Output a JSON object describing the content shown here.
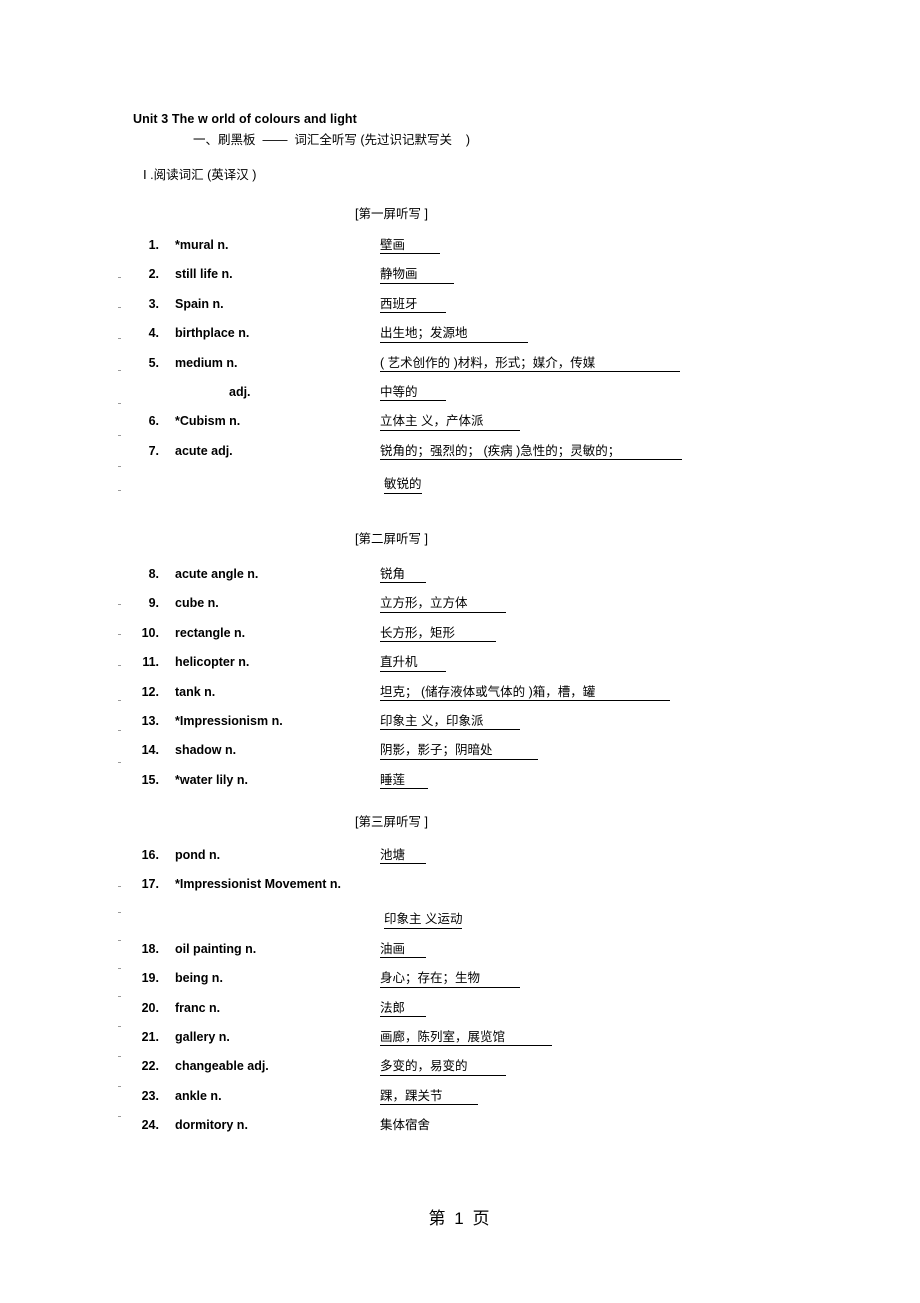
{
  "document": {
    "title": "Unit 3 The w orld of colours and light",
    "subtitle": "一、刷黑板  ——  词汇全听写 (先过识记默写关    )",
    "section_heading": "Ⅰ .阅读词汇 (英译汉 )",
    "page_footer_prefix": "第",
    "page_number": "1",
    "page_footer_suffix": "页"
  },
  "screens": [
    {
      "label": "[第一屏听写  ]",
      "entries": [
        {
          "num": "1.",
          "term": "*mural  n.",
          "meaning": "壁画",
          "indent": false
        },
        {
          "num": "2.",
          "term": "still life n.",
          "meaning": "静物画",
          "indent": false
        },
        {
          "num": "3.",
          "term": "Spain n.",
          "meaning": "西班牙",
          "indent": false
        },
        {
          "num": "4.",
          "term": "birthplace n.",
          "meaning": "出生地；发源地",
          "indent": false
        },
        {
          "num": "5.",
          "term": "medium n.",
          "meaning": "( 艺术创作的  )材料，形式；媒介，传媒",
          "indent": false
        },
        {
          "num": "",
          "term": "adj.",
          "meaning": "中等的",
          "indent": true
        },
        {
          "num": "6.",
          "term": "*Cubism n.",
          "meaning": "立体主 义，产体派",
          "indent": false
        },
        {
          "num": "7.",
          "term": "acute adj.",
          "meaning": "锐角的；强烈的； (疾病 )急性的；灵敏的；",
          "indent": false,
          "continuation": "敏锐的"
        }
      ]
    },
    {
      "label": "[第二屏听写  ]",
      "entries": [
        {
          "num": "8.",
          "term": "acute angle n.",
          "meaning": "锐角",
          "indent": false
        },
        {
          "num": "9.",
          "term": "cube n.",
          "meaning": "立方形，立方体",
          "indent": false
        },
        {
          "num": "10.",
          "term": "rectangle n.",
          "meaning": "长方形，矩形",
          "indent": false
        },
        {
          "num": "11.",
          "term": "helicopter n.",
          "meaning": "直升机",
          "indent": false
        },
        {
          "num": "12.",
          "term": "tank n.",
          "meaning": "坦克； (储存液体或气体的      )箱，槽，罐",
          "indent": false
        },
        {
          "num": "13.",
          "term": "*Impressionism n.",
          "meaning": "印象主 义，印象派",
          "indent": false
        },
        {
          "num": "14.",
          "term": "shadow n.",
          "meaning": "阴影，影子；阴暗处",
          "indent": false
        },
        {
          "num": "15.",
          "term": "*water lily  n.",
          "meaning": "睡莲",
          "indent": false
        }
      ]
    },
    {
      "label": "[第三屏听写  ]",
      "entries": [
        {
          "num": "16.",
          "term": "pond n.",
          "meaning": "池塘",
          "indent": false
        },
        {
          "num": "17.",
          "term": "*Impressionist Movement n.",
          "meaning": "",
          "indent": false,
          "continuation": "印象主 义运动"
        },
        {
          "num": "18.",
          "term": "oil painting n.",
          "meaning": "油画",
          "indent": false
        },
        {
          "num": "19.",
          "term": "being n.",
          "meaning": "身心；存在；生物",
          "indent": false
        },
        {
          "num": "20.",
          "term": "franc n.",
          "meaning": "法郎",
          "indent": false
        },
        {
          "num": "21.",
          "term": "gallery n.",
          "meaning": "画廊，陈列室，展览馆",
          "indent": false
        },
        {
          "num": "22.",
          "term": "changeable adj.",
          "meaning": "多变的，易变的",
          "indent": false
        },
        {
          "num": "23.",
          "term": "ankle n.",
          "meaning": "踝，踝关节",
          "indent": false
        },
        {
          "num": "24.",
          "term": "dormitory n.",
          "meaning": "集体宿舍",
          "indent": false
        }
      ]
    }
  ]
}
